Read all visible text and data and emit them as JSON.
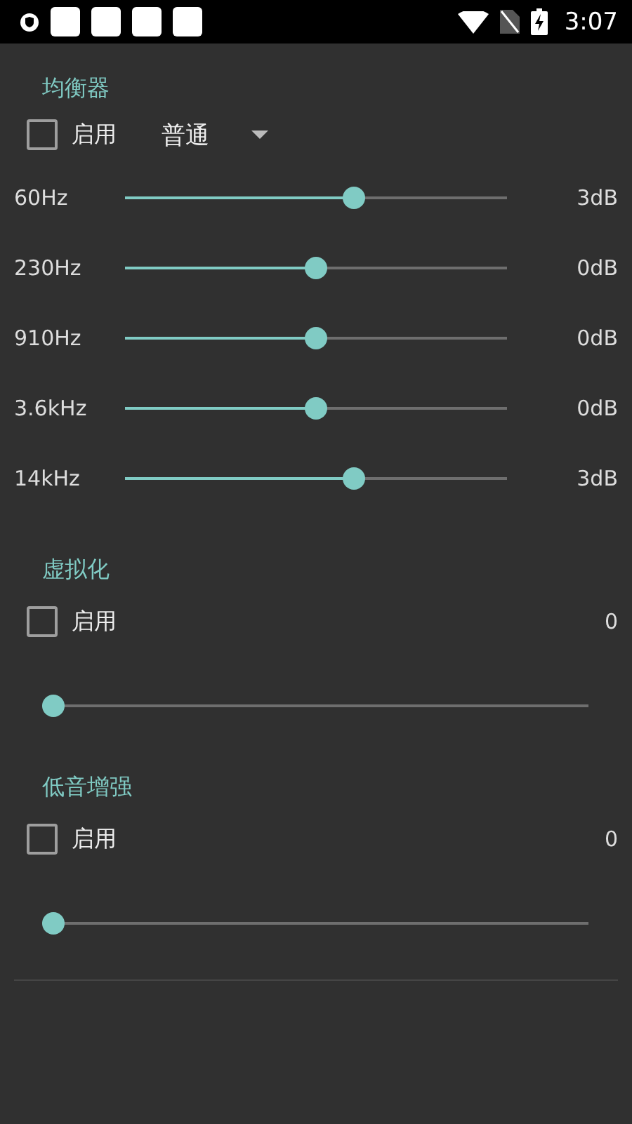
{
  "status_bar": {
    "time": "3:07"
  },
  "equalizer": {
    "title": "均衡器",
    "enable": {
      "label": "启用",
      "checked": false
    },
    "preset": "普通",
    "bands": [
      {
        "label": "60Hz",
        "level": 0.6,
        "reading": "3dB"
      },
      {
        "label": "230Hz",
        "level": 0.5,
        "reading": "0dB"
      },
      {
        "label": "910Hz",
        "level": 0.5,
        "reading": "0dB"
      },
      {
        "label": "3.6kHz",
        "level": 0.5,
        "reading": "0dB"
      },
      {
        "label": "14kHz",
        "level": 0.6,
        "reading": "3dB"
      }
    ]
  },
  "effects": [
    {
      "title": "虚拟化",
      "enable": {
        "label": "启用",
        "checked": false
      },
      "reading": "0",
      "level": 0
    },
    {
      "title": "低音增强",
      "enable": {
        "label": "启用",
        "checked": false
      },
      "reading": "0",
      "level": 0
    }
  ]
}
